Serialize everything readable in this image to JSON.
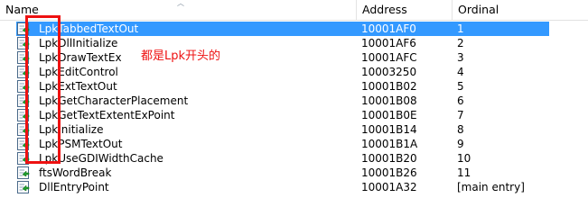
{
  "columns": {
    "name": "Name",
    "address": "Address",
    "ordinal": "Ordinal"
  },
  "rows": [
    {
      "name": "LpkTabbedTextOut",
      "address": "10001AF0",
      "ordinal": "1",
      "selected": true
    },
    {
      "name": "LpkDllInitialize",
      "address": "10001AF6",
      "ordinal": "2"
    },
    {
      "name": "LpkDrawTextEx",
      "address": "10001AFC",
      "ordinal": "3"
    },
    {
      "name": "LpkEditControl",
      "address": "10003250",
      "ordinal": "4"
    },
    {
      "name": "LpkExtTextOut",
      "address": "10001B02",
      "ordinal": "5"
    },
    {
      "name": "LpkGetCharacterPlacement",
      "address": "10001B08",
      "ordinal": "6"
    },
    {
      "name": "LpkGetTextExtentExPoint",
      "address": "10001B0E",
      "ordinal": "7"
    },
    {
      "name": "LpkInitialize",
      "address": "10001B14",
      "ordinal": "8"
    },
    {
      "name": "LpkPSMTextOut",
      "address": "10001B1A",
      "ordinal": "9"
    },
    {
      "name": "LpkUseGDIWidthCache",
      "address": "10001B20",
      "ordinal": "10"
    },
    {
      "name": "ftsWordBreak",
      "address": "10001B26",
      "ordinal": "11"
    },
    {
      "name": "DllEntryPoint",
      "address": "10001A32",
      "ordinal": "[main entry]"
    }
  ],
  "row_icon": "export-function-icon",
  "annotation": {
    "text": "都是Lpk开头的",
    "color": "#ee1111"
  },
  "colors": {
    "selection": "#3399ff",
    "annotation_box": "#ee1111"
  }
}
